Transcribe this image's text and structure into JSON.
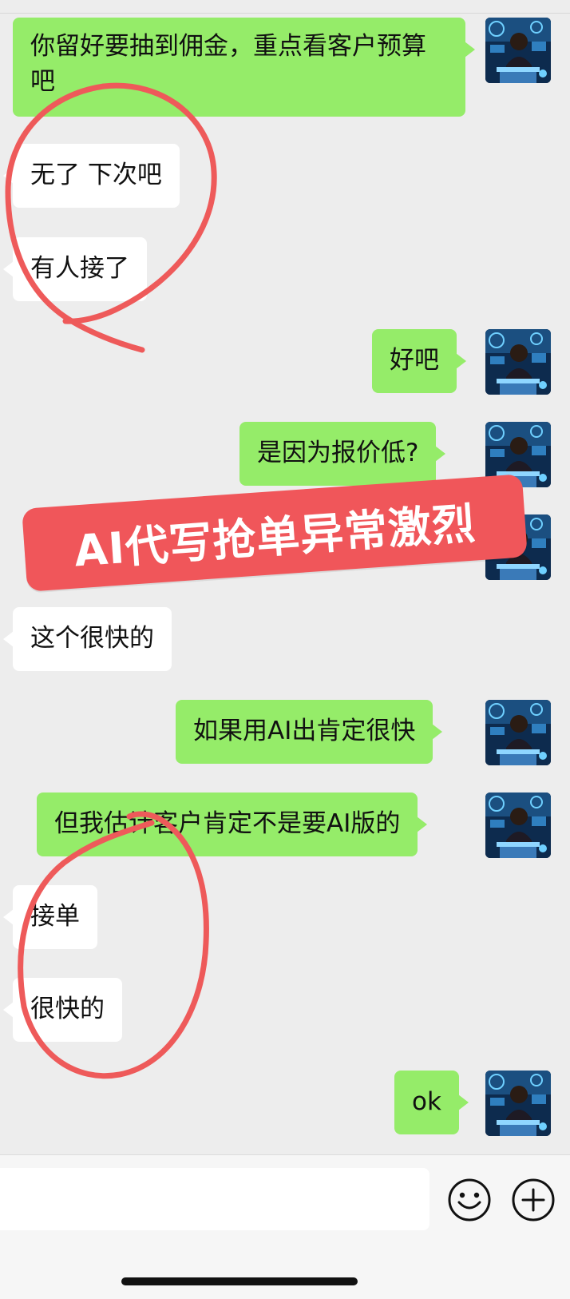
{
  "messages": [
    {
      "side": "out",
      "text": "你留好要抽到佣金，重点看客户预算吧"
    },
    {
      "side": "in",
      "text": "无了 下次吧"
    },
    {
      "side": "in",
      "text": "有人接了"
    },
    {
      "side": "out",
      "text": "好吧"
    },
    {
      "side": "out",
      "text": "是因为报价低?"
    },
    {
      "side": "in",
      "text": "这个很快的"
    },
    {
      "side": "out",
      "text": "如果用AI出肯定很快"
    },
    {
      "side": "out",
      "text": "但我估计客户肯定不是要AI版的"
    },
    {
      "side": "in",
      "text": "接单"
    },
    {
      "side": "in",
      "text": "很快的"
    },
    {
      "side": "out",
      "text": "ok"
    }
  ],
  "overlay": {
    "banner_text": "AI代写抢单异常激烈",
    "banner_color": "#f0565a",
    "circle_color": "#ee5a5a"
  },
  "input_bar": {
    "placeholder": "",
    "emoji_icon": "smiley-face-icon",
    "plus_icon": "plus-circle-icon"
  },
  "colors": {
    "outgoing_bubble": "#95ec69",
    "incoming_bubble": "#ffffff",
    "background": "#ededed"
  }
}
